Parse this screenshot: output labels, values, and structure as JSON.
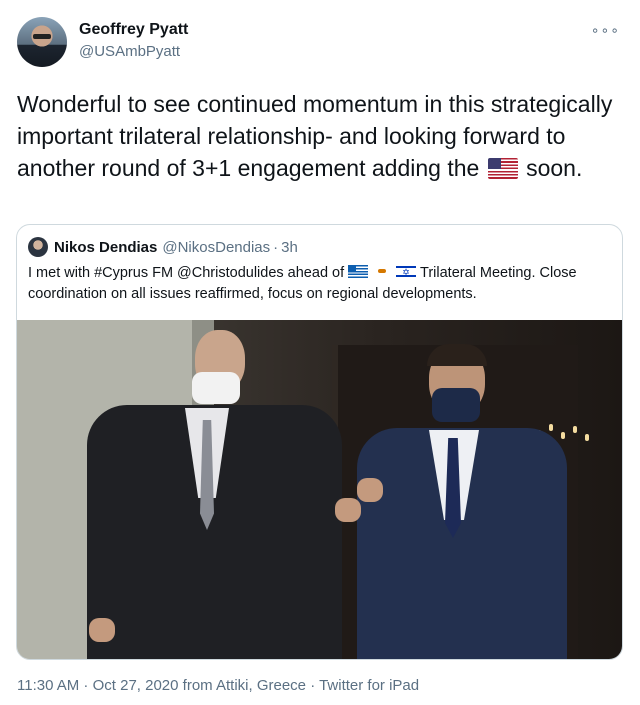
{
  "author": {
    "name": "Geoffrey Pyatt",
    "handle": "@USAmbPyatt"
  },
  "menu_icon": "more-dots-icon",
  "tweet": {
    "text_part1": "Wonderful to see continued momentum in this strategically important trilateral relationship- and looking forward to another round of 3+1 engagement adding the",
    "flag": "us-flag-emoji",
    "text_part2": "soon."
  },
  "quoted": {
    "name": "Nikos Dendias",
    "handle": "@NikosDendias",
    "separator": "·",
    "time": "3h",
    "text_part1": "I met with #Cyprus FM @Christodulides ahead of",
    "flags": [
      "greece-flag-emoji",
      "cyprus-flag-emoji",
      "israel-flag-emoji"
    ],
    "text_part2": "Trilateral Meeting. Close coordination on all issues reaffirmed, focus on regional developments."
  },
  "footer": {
    "text": "11:30 AM · Oct 27, 2020 from Attiki, Greece · Twitter for iPad"
  }
}
